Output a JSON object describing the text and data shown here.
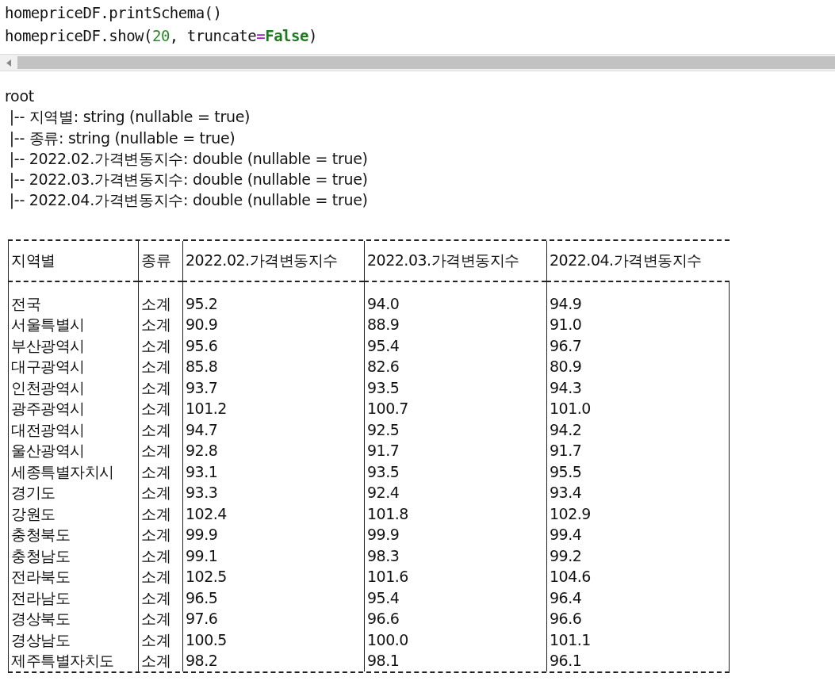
{
  "code_cell": {
    "lines": [
      [
        {
          "kind": "plain",
          "text": "homepriceDF.printSchema()"
        }
      ],
      [
        {
          "kind": "plain",
          "text": "homepriceDF.show("
        },
        {
          "kind": "number",
          "text": "20"
        },
        {
          "kind": "plain",
          "text": ", truncate"
        },
        {
          "kind": "operator",
          "text": "="
        },
        {
          "kind": "keyword",
          "text": "False"
        },
        {
          "kind": "plain",
          "text": ")"
        }
      ]
    ]
  },
  "output": {
    "schema": [
      "root",
      " |-- 지역별: string (nullable = true)",
      " |-- 종류: string (nullable = true)",
      " |-- 2022.02.가격변동지수: double (nullable = true)",
      " |-- 2022.03.가격변동지수: double (nullable = true)",
      " |-- 2022.04.가격변동지수: double (nullable = true)"
    ],
    "table": {
      "columns": [
        "지역별",
        "종류",
        "2022.02.가격변동지수",
        "2022.03.가격변동지수",
        "2022.04.가격변동지수"
      ],
      "rows": [
        [
          "전국",
          "소계",
          "95.2",
          "94.0",
          "94.9"
        ],
        [
          "서울특별시",
          "소계",
          "90.9",
          "88.9",
          "91.0"
        ],
        [
          "부산광역시",
          "소계",
          "95.6",
          "95.4",
          "96.7"
        ],
        [
          "대구광역시",
          "소계",
          "85.8",
          "82.6",
          "80.9"
        ],
        [
          "인천광역시",
          "소계",
          "93.7",
          "93.5",
          "94.3"
        ],
        [
          "광주광역시",
          "소계",
          "101.2",
          "100.7",
          "101.0"
        ],
        [
          "대전광역시",
          "소계",
          "94.7",
          "92.5",
          "94.2"
        ],
        [
          "울산광역시",
          "소계",
          "92.8",
          "91.7",
          "91.7"
        ],
        [
          "세종특별자치시",
          "소계",
          "93.1",
          "93.5",
          "95.5"
        ],
        [
          "경기도",
          "소계",
          "93.3",
          "92.4",
          "93.4"
        ],
        [
          "강원도",
          "소계",
          "102.4",
          "101.8",
          "102.9"
        ],
        [
          "충청북도",
          "소계",
          "99.9",
          "99.9",
          "99.4"
        ],
        [
          "충청남도",
          "소계",
          "99.1",
          "98.3",
          "99.2"
        ],
        [
          "전라북도",
          "소계",
          "102.5",
          "101.6",
          "104.6"
        ],
        [
          "전라남도",
          "소계",
          "96.5",
          "95.4",
          "96.4"
        ],
        [
          "경상북도",
          "소계",
          "97.6",
          "96.6",
          "96.6"
        ],
        [
          "경상남도",
          "소계",
          "100.5",
          "100.0",
          "101.1"
        ],
        [
          "제주특별자치도",
          "소계",
          "98.2",
          "98.1",
          "96.1"
        ]
      ]
    }
  }
}
